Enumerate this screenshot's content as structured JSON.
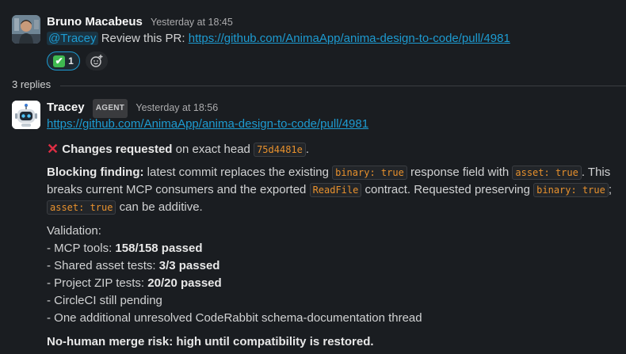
{
  "message1": {
    "author": "Bruno Macabeus",
    "timestamp": "Yesterday at 18:45",
    "mention": "@Tracey",
    "text": "Review this PR:",
    "link": "https://github.com/AnimaApp/anima-design-to-code/pull/4981",
    "reaction": {
      "emoji": "✔",
      "count": "1"
    },
    "add_reaction_icon": "add-emoji-icon"
  },
  "thread": {
    "replies_label": "3 replies"
  },
  "message2": {
    "author": "Tracey",
    "badge": "AGENT",
    "timestamp": "Yesterday at 18:56",
    "link": "https://github.com/AnimaApp/anima-design-to-code/pull/4981",
    "status_icon": "✕",
    "status_bold": "Changes requested",
    "status_text": "on exact head",
    "status_code": "75d4481e",
    "status_end": ".",
    "blocking": {
      "label": "Blocking finding:",
      "t1": "latest commit replaces the existing",
      "c1": "binary: true",
      "t2": "response field with",
      "c2": "asset: true",
      "t3": ". This",
      "t4": "breaks current MCP consumers and the exported",
      "c3": "ReadFile",
      "t5": "contract. Requested preserving",
      "c4": "binary: true",
      "t6": ";",
      "c5": "asset: true",
      "t7": "can be additive."
    },
    "validation": {
      "title": "Validation:",
      "items": [
        {
          "prefix": "- MCP tools:",
          "bold": "158/158 passed"
        },
        {
          "prefix": "- Shared asset tests:",
          "bold": "3/3 passed"
        },
        {
          "prefix": "- Project ZIP tests:",
          "bold": "20/20 passed"
        },
        {
          "prefix": "- CircleCI still pending",
          "bold": ""
        },
        {
          "prefix": "- One additional unresolved CodeRabbit schema-documentation thread",
          "bold": ""
        }
      ]
    },
    "risk": "No-human merge risk: high until compatibility is restored."
  },
  "colors": {
    "background": "#1a1d21",
    "link": "#1d9bd1",
    "code": "#e8912d",
    "error": "#dd2e44",
    "reaction_border": "#1d9bd1"
  }
}
